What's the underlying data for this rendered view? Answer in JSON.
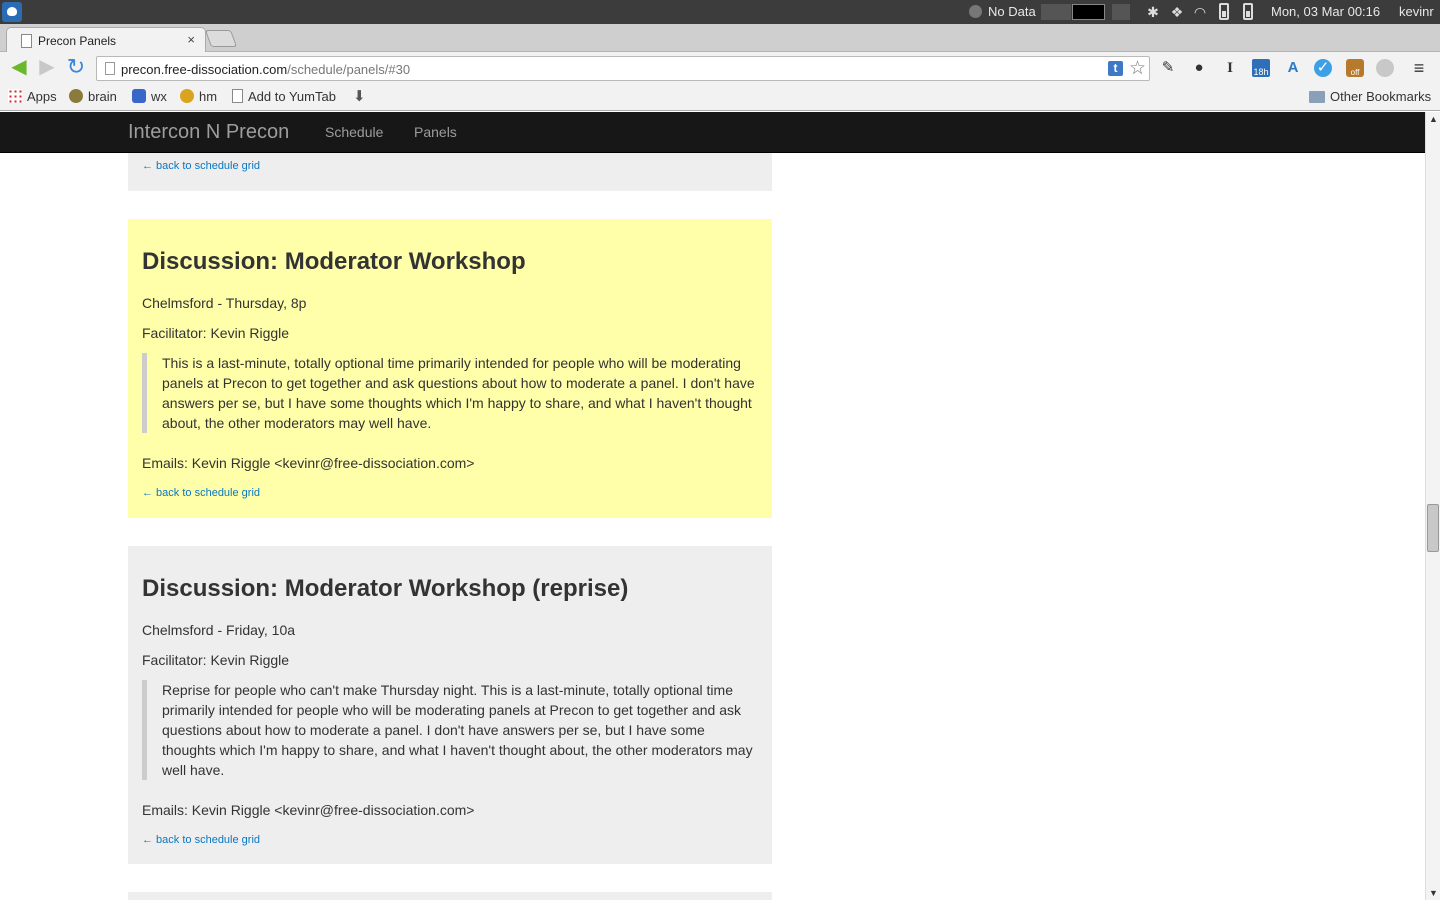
{
  "system": {
    "status_text": "No Data",
    "datetime": "Mon, 03 Mar  00:16",
    "user": "kevinr"
  },
  "browser": {
    "tab_title": "Precon Panels",
    "tab_close": "×",
    "url_host": "precon.free-dissociation.com",
    "url_path": "/schedule/panels/#30",
    "ext_t_label": "t",
    "cal_badge": "18h",
    "off_badge": "off",
    "icons": [
      "back-arrow-icon",
      "forward-arrow-icon",
      "reload-icon",
      "bookmark-star-icon",
      "pin-icon",
      "spy-glasses-icon",
      "instapaper-icon",
      "calendar-icon",
      "translate-icon",
      "checkmark-icon",
      "off-badge-icon",
      "globe-icon",
      "menu-icon"
    ]
  },
  "bookmarks": {
    "apps": "Apps",
    "brain": "brain",
    "wx": "wx",
    "hm": "hm",
    "yumtab": "Add to YumTab",
    "other": "Other Bookmarks"
  },
  "site": {
    "brand": "Intercon N Precon",
    "nav_schedule": "Schedule",
    "nav_panels": "Panels"
  },
  "panels": [
    {
      "back_link": "← back to schedule grid"
    },
    {
      "title": "Discussion: Moderator Workshop",
      "location_time": "Chelmsford - Thursday, 8p",
      "facilitator": "Facilitator: Kevin Riggle",
      "description": "This is a last-minute, totally optional time primarily intended for people who will be moderating panels at Precon to get together and ask questions about how to moderate a panel. I don't have answers per se, but I have some thoughts which I'm happy to share, and what I haven't thought about, the other moderators may well have.",
      "emails": "Emails: Kevin Riggle <kevinr@free-dissociation.com>",
      "back_link": "← back to schedule grid",
      "highlighted": true
    },
    {
      "title": "Discussion: Moderator Workshop (reprise)",
      "location_time": "Chelmsford - Friday, 10a",
      "facilitator": "Facilitator: Kevin Riggle",
      "description": "Reprise for people who can't make Thursday night. This is a last-minute, totally optional time primarily intended for people who will be moderating panels at Precon to get together and ask questions about how to moderate a panel. I don't have answers per se, but I have some thoughts which I'm happy to share, and what I haven't thought about, the other moderators may well have.",
      "emails": "Emails: Kevin Riggle <kevinr@free-dissociation.com>",
      "back_link": "← back to schedule grid",
      "highlighted": false
    }
  ],
  "colors": {
    "navbar_bg": "#171717",
    "highlight_bg": "#ffffaa",
    "card_bg": "#eeeeee",
    "link": "#0a77c4"
  }
}
